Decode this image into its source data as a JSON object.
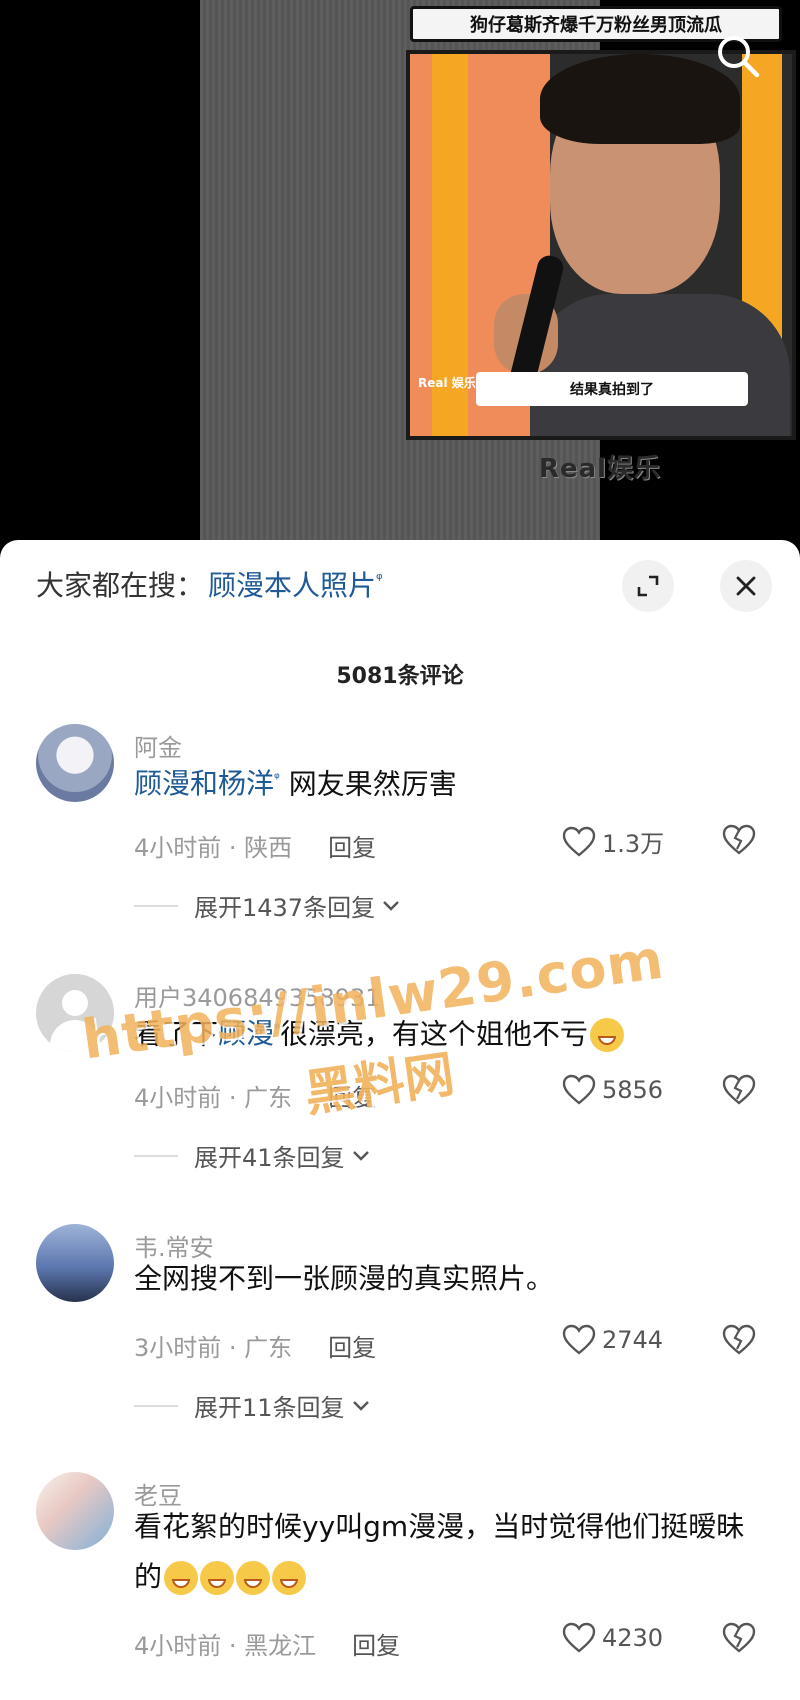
{
  "video": {
    "title": "狗仔葛斯齐爆千万粉丝男顶流瓜",
    "subtitle": "结果真拍到了",
    "logo": "Real 娱乐",
    "watermark": "Real娱乐"
  },
  "sheet": {
    "trending_prefix": "大家都在搜：",
    "trending_query": "顾漫本人照片",
    "comment_count": "5081条评论"
  },
  "comments": [
    {
      "username": "阿金",
      "text_highlight": "顾漫和杨洋",
      "text_rest": "  网友果然厉害",
      "time_location": "4小时前 · 陕西",
      "reply": "回复",
      "likes": "1.3万",
      "expand": "展开1437条回复"
    },
    {
      "username": "用户3406849358931",
      "text_before": "看了下",
      "text_highlight": "顾漫",
      "text_rest": "很漂亮，有这个姐他不亏",
      "time_location": "4小时前 · 广东",
      "reply": "回复",
      "likes": "5856",
      "expand": "展开41条回复"
    },
    {
      "username": "韦.常安",
      "text": "全网搜不到一张顾漫的真实照片。",
      "time_location": "3小时前 · 广东",
      "reply": "回复",
      "likes": "2744",
      "expand": "展开11条回复"
    },
    {
      "username": "老豆",
      "text": "看花絮的时候yy叫gm漫漫，当时觉得他们挺暧昧的",
      "time_location": "4小时前 · 黑龙江",
      "reply": "回复",
      "likes": "4230"
    }
  ],
  "overlay_watermark": {
    "url": "https://inlw29.com",
    "name": "黑料网"
  },
  "icons": [
    "search-icon",
    "expand-icon",
    "close-icon",
    "heart-icon",
    "broken-heart-icon",
    "chevron-down-icon",
    "search-mini-icon"
  ]
}
